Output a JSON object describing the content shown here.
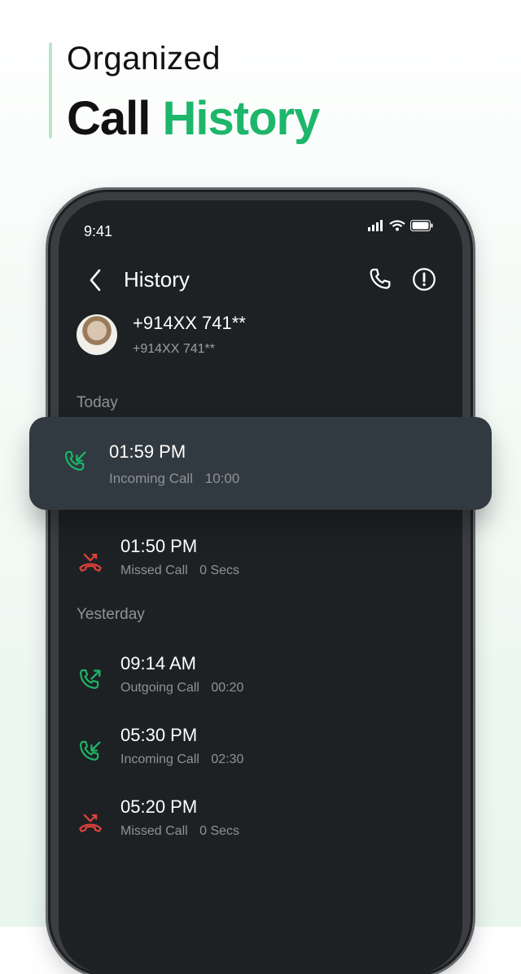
{
  "promo": {
    "line1": "Organized",
    "line2_part1": "Call",
    "line2_part2": "History",
    "accent_color": "#1db66a"
  },
  "status_bar": {
    "time": "9:41",
    "icons": [
      "signal-icon",
      "wifi-icon",
      "battery-icon"
    ]
  },
  "header": {
    "title": "History",
    "back_icon": "chevron-left-icon",
    "call_icon": "phone-icon",
    "info_icon": "info-icon"
  },
  "contact": {
    "name": "+914XX 741**",
    "number": "+914XX 741**"
  },
  "sections": [
    {
      "label": "Today",
      "calls": [
        {
          "time": "01:59 PM",
          "type": "Incoming Call",
          "duration": "10:00",
          "icon": "incoming-call-icon",
          "color": "#1db66a"
        },
        {
          "time": "01:50 PM",
          "type": "Missed Call",
          "duration": "0 Secs",
          "icon": "missed-call-icon",
          "color": "#e2413b"
        }
      ]
    },
    {
      "label": "Yesterday",
      "calls": [
        {
          "time": "09:14 AM",
          "type": "Outgoing Call",
          "duration": "00:20",
          "icon": "outgoing-call-icon",
          "color": "#1db66a"
        },
        {
          "time": "05:30 PM",
          "type": "Incoming Call",
          "duration": "02:30",
          "icon": "incoming-call-icon",
          "color": "#1db66a"
        },
        {
          "time": "05:20 PM",
          "type": "Missed Call",
          "duration": "0 Secs",
          "icon": "missed-call-icon",
          "color": "#e2413b"
        }
      ]
    }
  ]
}
